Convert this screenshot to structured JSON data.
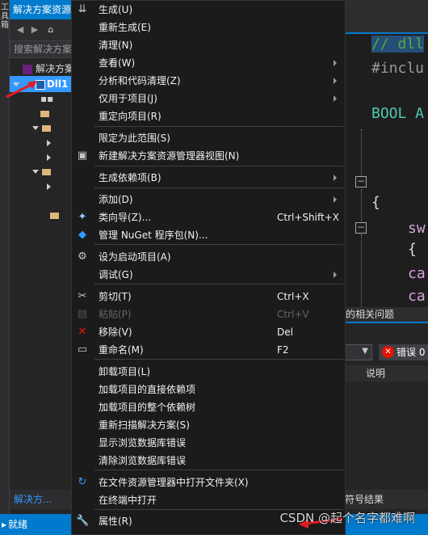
{
  "left_strip": {
    "label": "工具箱"
  },
  "solution_explorer": {
    "title": "解决方案资源",
    "search_placeholder": "搜索解决方案",
    "tree": [
      {
        "label": "解决方案"
      },
      {
        "label": "Dll1"
      }
    ],
    "bottom_tab": "解决方..."
  },
  "editor": {
    "lines": [
      {
        "text": "// dll",
        "color": "#57a64a"
      },
      {
        "text": "#inclu",
        "color": "#9b9b9b"
      },
      {
        "text": "BOOL A",
        "color": "#4ec9b0"
      },
      {
        "text": "{",
        "color": "#dcdcdc"
      },
      {
        "text": "sw",
        "color": "#d8a0df"
      },
      {
        "text": "{",
        "color": "#dcdcdc"
      },
      {
        "text": "ca",
        "color": "#d8a0df"
      },
      {
        "text": "ca",
        "color": "#d8a0df"
      }
    ]
  },
  "error_panel": {
    "header": "的相关问题",
    "error_button": "错误 0",
    "column_header": "说明",
    "symbol_tab": "符号结果"
  },
  "status_bar": {
    "text": "就绪"
  },
  "watermark": "CSDN @起个名字都难啊",
  "context_menu": {
    "items": [
      {
        "label": "生成(U)",
        "icon": "build-icon"
      },
      {
        "label": "重新生成(E)"
      },
      {
        "label": "清理(N)"
      },
      {
        "label": "查看(W)",
        "submenu": true
      },
      {
        "label": "分析和代码清理(Z)",
        "submenu": true
      },
      {
        "label": "仅用于项目(J)",
        "submenu": true
      },
      {
        "label": "重定向项目(R)"
      },
      {
        "label": "限定为此范围(S)"
      },
      {
        "label": "新建解决方案资源管理器视图(N)",
        "icon": "new-view-icon"
      },
      {
        "label": "生成依赖项(B)",
        "submenu": true
      },
      {
        "label": "添加(D)",
        "submenu": true
      },
      {
        "label": "类向导(Z)...",
        "shortcut": "Ctrl+Shift+X",
        "icon": "class-wizard-icon"
      },
      {
        "label": "管理 NuGet 程序包(N)...",
        "icon": "nuget-icon"
      },
      {
        "label": "设为启动项目(A)",
        "icon": "gear-icon"
      },
      {
        "label": "调试(G)",
        "submenu": true
      },
      {
        "label": "剪切(T)",
        "shortcut": "Ctrl+X",
        "icon": "scissors-icon"
      },
      {
        "label": "粘贴(P)",
        "shortcut": "Ctrl+V",
        "icon": "paste-icon",
        "disabled": true
      },
      {
        "label": "移除(V)",
        "shortcut": "Del",
        "icon": "remove-icon"
      },
      {
        "label": "重命名(M)",
        "shortcut": "F2",
        "icon": "rename-icon"
      },
      {
        "label": "卸载项目(L)"
      },
      {
        "label": "加载项目的直接依赖项"
      },
      {
        "label": "加载项目的整个依赖树"
      },
      {
        "label": "重新扫描解决方案(S)"
      },
      {
        "label": "显示浏览数据库错误"
      },
      {
        "label": "清除浏览数据库错误"
      },
      {
        "label": "在文件资源管理器中打开文件夹(X)",
        "icon": "refresh-folder-icon"
      },
      {
        "label": "在终端中打开"
      },
      {
        "label": "属性(R)",
        "icon": "wrench-icon"
      }
    ]
  },
  "colors": {
    "accent": "#007acc",
    "menu_bg": "#1b1b1c",
    "selection": "#3399ff",
    "error_red": "#e51400",
    "annotation_arrow": "#e51c23"
  }
}
